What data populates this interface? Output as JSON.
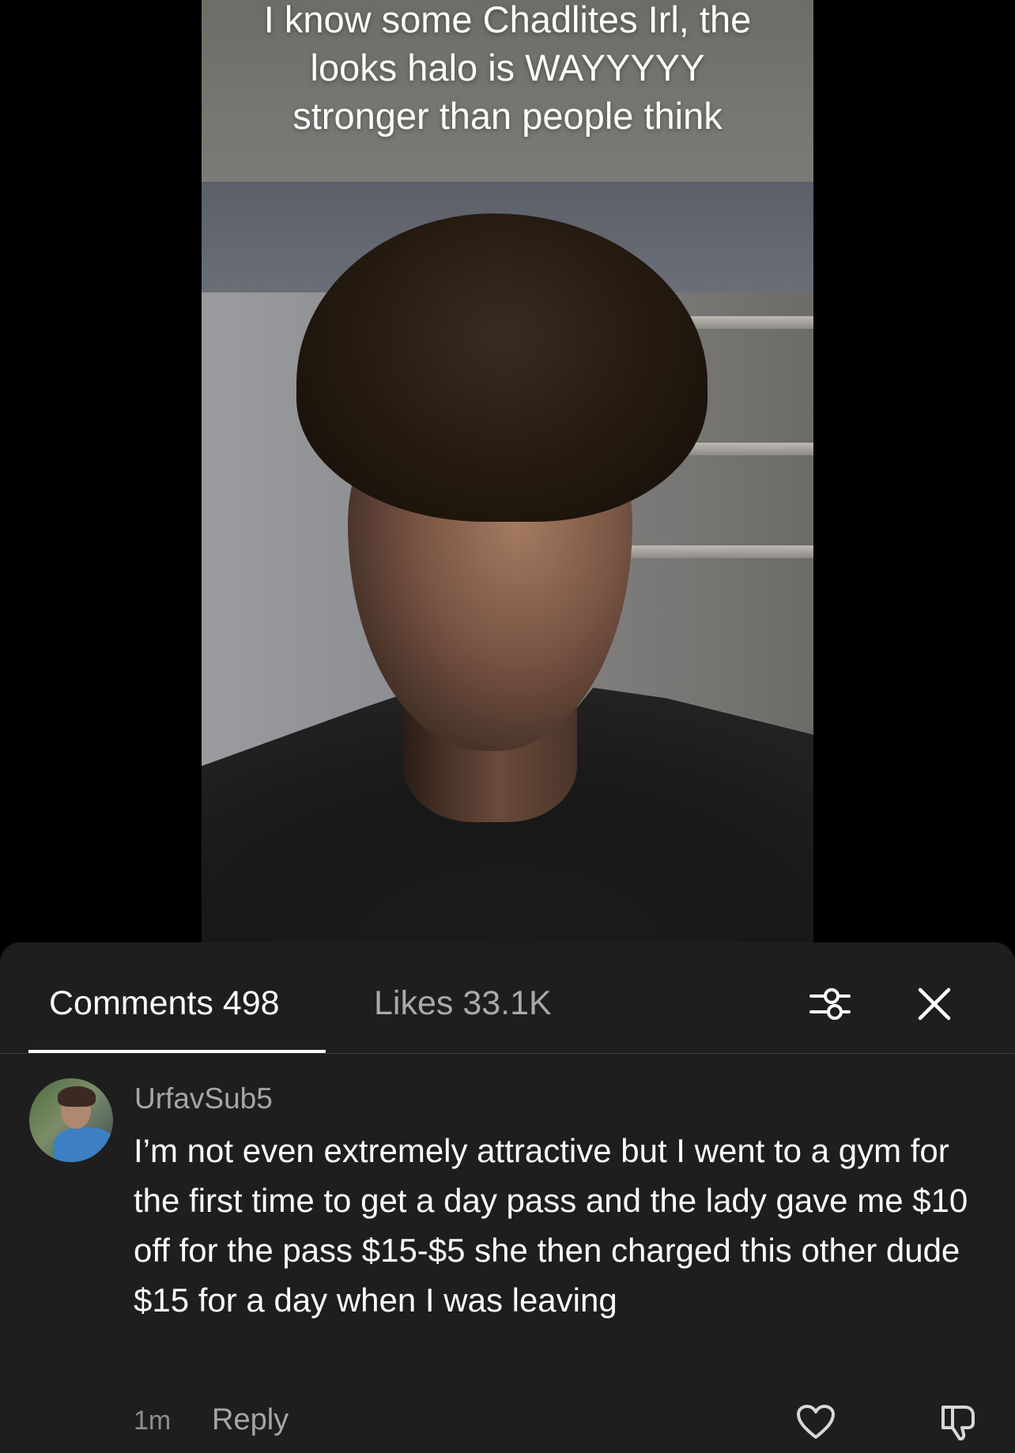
{
  "video": {
    "caption": "I know some Chadlites Irl, the\nlooks halo is WAYYYYY\nstronger than people think"
  },
  "sheet": {
    "tabs": {
      "comments_label": "Comments 498",
      "likes_label": "Likes 33.1K"
    },
    "icons": {
      "filter": "filter-sliders-icon",
      "close": "close-icon"
    }
  },
  "comment": {
    "username": "UrfavSub5",
    "text": "I’m not even extremely attractive but I went to a gym for the first time to get a day pass and the lady gave me $10 off for the pass $15-$5 she then charged this other dude $15 for a day when I was leaving",
    "time": "1m",
    "reply_label": "Reply",
    "icons": {
      "like": "heart-icon",
      "dislike": "thumbs-down-icon"
    }
  },
  "colors": {
    "sheet_background": "#1e1e1e",
    "active_tab": "#ffffff",
    "inactive_tab": "#a9a9a9",
    "secondary_text": "#a6a6a6"
  }
}
